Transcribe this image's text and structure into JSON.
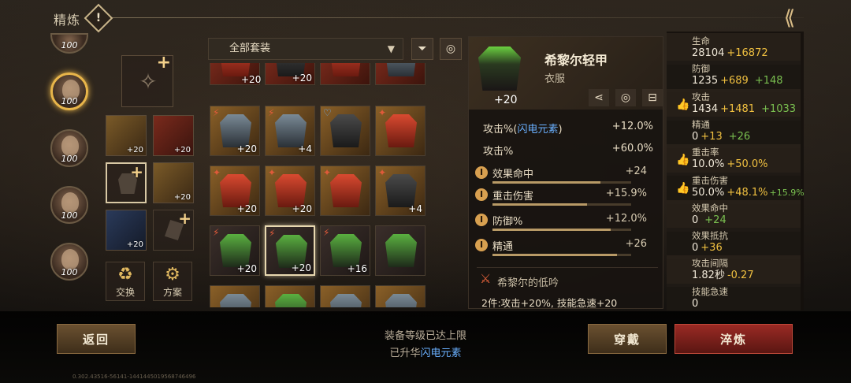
{
  "header": {
    "title": "精炼",
    "info_label": "!"
  },
  "heroes": [
    {
      "level": "100"
    },
    {
      "level": "100"
    },
    {
      "level": "100"
    },
    {
      "level": "100"
    },
    {
      "level": "100"
    }
  ],
  "slots": [
    {
      "count": "+20"
    },
    {
      "count": "+20"
    },
    {
      "count": "+20"
    },
    {
      "count": "+20"
    }
  ],
  "actions": {
    "swap": "交换",
    "plan": "方案"
  },
  "filter": {
    "selected": "全部套装",
    "filter_icon": "filter-icon",
    "sort_icon": "coins-icon"
  },
  "inventory": [
    {
      "count": ""
    },
    {
      "count": "+20"
    },
    {
      "count": ""
    },
    {
      "count": ""
    },
    {
      "count": "+20"
    },
    {
      "count": "+4"
    },
    {
      "count": ""
    },
    {
      "count": ""
    },
    {
      "count": "+20"
    },
    {
      "count": "+20"
    },
    {
      "count": ""
    },
    {
      "count": "+4"
    },
    {
      "count": "+20"
    },
    {
      "count": "+20"
    },
    {
      "count": "+16"
    },
    {
      "count": ""
    },
    {
      "count": ""
    },
    {
      "count": ""
    },
    {
      "count": ""
    },
    {
      "count": ""
    }
  ],
  "detail": {
    "name": "希黎尔轻甲",
    "type": "衣服",
    "count": "+20",
    "main_stats": [
      {
        "label_prefix": "攻击%(",
        "label_hl": "闪电元素",
        "label_suffix": ")",
        "value": "+12.0%"
      },
      {
        "label_prefix": "攻击%",
        "label_hl": "",
        "label_suffix": "",
        "value": "+60.0%"
      }
    ],
    "sub_stats": [
      {
        "name": "效果命中",
        "value": "+24",
        "fill": 0.78
      },
      {
        "name": "重击伤害",
        "value": "+15.9%",
        "fill": 0.68
      },
      {
        "name": "防御%",
        "value": "+12.0%",
        "fill": 0.85
      },
      {
        "name": "精通",
        "value": "+26",
        "fill": 0.9
      }
    ],
    "set_name": "希黎尔的低吟",
    "set_desc": "2件:攻击+20%, 技能急速+20"
  },
  "attributes": [
    {
      "name": "生命",
      "base": "28104",
      "add1": "+16872",
      "add2": "",
      "thumb": false
    },
    {
      "name": "防御",
      "base": "1235",
      "add1": "+689",
      "add2": "+148",
      "thumb": false
    },
    {
      "name": "攻击",
      "base": "1434",
      "add1": "+1481",
      "add2": "+1033",
      "thumb": true
    },
    {
      "name": "精通",
      "base": "0",
      "add1": "+13",
      "add2": "+26",
      "thumb": false
    },
    {
      "name": "重击率",
      "base": "10.0%",
      "add1": "+50.0%",
      "add2": "",
      "thumb": true
    },
    {
      "name": "重击伤害",
      "base": "50.0%",
      "add1": "+48.1%",
      "add2": "+15.9%",
      "thumb": true
    },
    {
      "name": "效果命中",
      "base": "0",
      "add1": "",
      "add2": "+24",
      "thumb": false
    },
    {
      "name": "效果抵抗",
      "base": "0",
      "add1": "+36",
      "add2": "",
      "thumb": false
    },
    {
      "name": "攻击间隔",
      "base": "1.82秒",
      "add1": "-0.27",
      "add2": "",
      "thumb": false
    },
    {
      "name": "技能急速",
      "base": "0",
      "add1": "",
      "add2": "",
      "thumb": false
    }
  ],
  "bottom": {
    "back": "返回",
    "msg1": "装备等级已达上限",
    "msg2_prefix": "已升华",
    "msg2_hl": "闪电元素",
    "wear": "穿戴",
    "refine": "淬炼",
    "build": "0.302.43516-56141-1441445019568746496"
  },
  "colors": {
    "accent_gold": "#f0c040",
    "accent_blue": "#6ab0ff",
    "accent_green": "#7ac050",
    "refine_red": "#9a2a24"
  }
}
